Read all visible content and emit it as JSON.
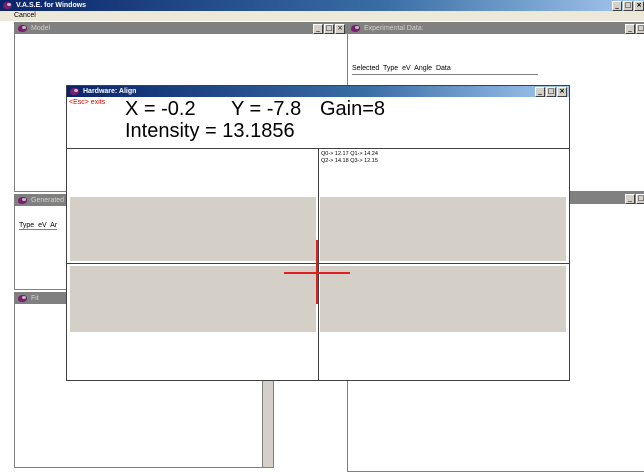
{
  "app": {
    "title": "V.A.S.E. for Windows",
    "menu_cancel": "Cancel"
  },
  "model_window": {
    "title": "Model"
  },
  "experimental_window": {
    "title": "Experimental Data:",
    "columns": [
      "Selected",
      "Type",
      "eV",
      "Angle",
      "Data"
    ]
  },
  "generated_window": {
    "title": "Generated",
    "columns": [
      "Type",
      "eV",
      "Ar"
    ]
  },
  "fit_window": {
    "title": "Fit"
  },
  "align_window": {
    "title": "Hardware: Align",
    "esc_hint": "<Esc> exits",
    "x_readout": "X = -0.2",
    "y_readout": "Y = -7.8",
    "gain_readout": "Gain=8",
    "intensity_readout": "Intensity = 13.1856",
    "quadrant_line1": "Q0-> 12.17  Q1-> 14.24",
    "quadrant_line2": "Q2-> 14.18  Q3-> 12.15"
  },
  "colors": {
    "crosshair": "#e02020",
    "hint": "#e00000",
    "panel": "#d4d0c8"
  }
}
